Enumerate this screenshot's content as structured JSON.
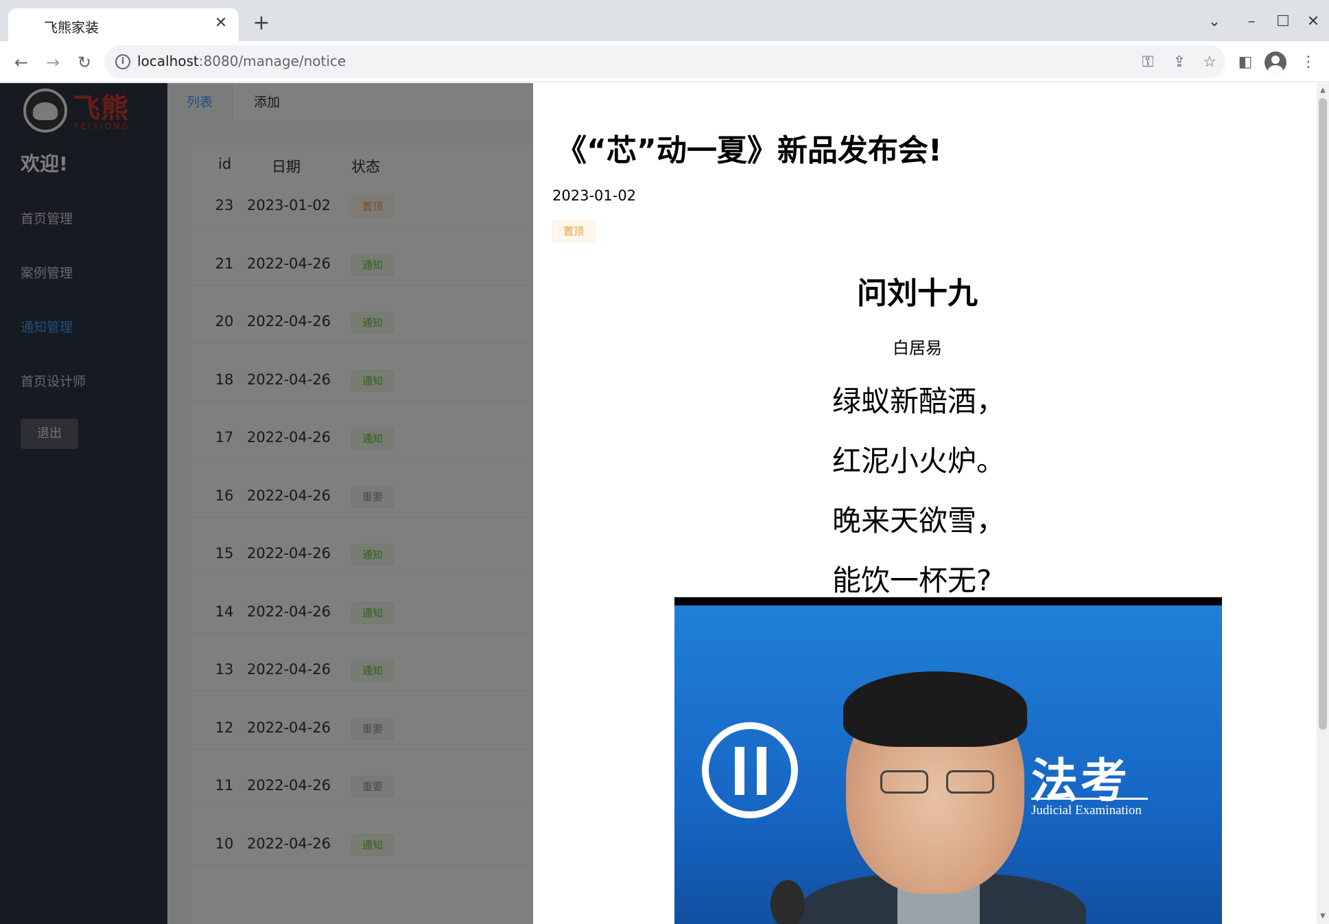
{
  "browser": {
    "tab_title": "飞熊家装",
    "url_host": "localhost",
    "url_rest": ":8080/manage/notice"
  },
  "sidebar": {
    "logo_cn": "飞熊",
    "logo_en": "FEIXIONG",
    "welcome": "欢迎!",
    "items": [
      {
        "label": "首页管理",
        "active": false
      },
      {
        "label": "案例管理",
        "active": false
      },
      {
        "label": "通知管理",
        "active": true
      },
      {
        "label": "首页设计师",
        "active": false
      }
    ],
    "logout_label": "退出"
  },
  "main": {
    "tabs": [
      {
        "label": "列表",
        "active": true
      },
      {
        "label": "添加",
        "active": false
      }
    ],
    "table": {
      "headers": [
        "id",
        "日期",
        "状态"
      ],
      "rows": [
        {
          "id": "23",
          "date": "2023-01-02",
          "status": "置顶",
          "kind": "top"
        },
        {
          "id": "21",
          "date": "2022-04-26",
          "status": "通知",
          "kind": "notice"
        },
        {
          "id": "20",
          "date": "2022-04-26",
          "status": "通知",
          "kind": "notice"
        },
        {
          "id": "18",
          "date": "2022-04-26",
          "status": "通知",
          "kind": "notice"
        },
        {
          "id": "17",
          "date": "2022-04-26",
          "status": "通知",
          "kind": "notice"
        },
        {
          "id": "16",
          "date": "2022-04-26",
          "status": "重要",
          "kind": "important"
        },
        {
          "id": "15",
          "date": "2022-04-26",
          "status": "通知",
          "kind": "notice"
        },
        {
          "id": "14",
          "date": "2022-04-26",
          "status": "通知",
          "kind": "notice"
        },
        {
          "id": "13",
          "date": "2022-04-26",
          "status": "通知",
          "kind": "notice"
        },
        {
          "id": "12",
          "date": "2022-04-26",
          "status": "重要",
          "kind": "important"
        },
        {
          "id": "11",
          "date": "2022-04-26",
          "status": "重要",
          "kind": "important"
        },
        {
          "id": "10",
          "date": "2022-04-26",
          "status": "通知",
          "kind": "notice"
        }
      ]
    }
  },
  "drawer": {
    "title": "《“芯”动一夏》新品发布会!",
    "date": "2023-01-02",
    "tag": "置顶",
    "poem": {
      "title": "问刘十九",
      "author": "白居易",
      "lines": [
        "绿蚁新醅酒，",
        "红泥小火炉。",
        "晚来天欲雪，",
        "能饮一杯无?"
      ]
    },
    "video": {
      "caption_cn": "法考",
      "caption_en": "Judicial Examination"
    }
  },
  "colors": {
    "accent": "#409eff",
    "sidebar_bg": "#2e3440",
    "tag_top": "#e6a23c",
    "tag_notice": "#67c23a",
    "tag_important": "#909399",
    "logo_red": "#d23a2e"
  }
}
